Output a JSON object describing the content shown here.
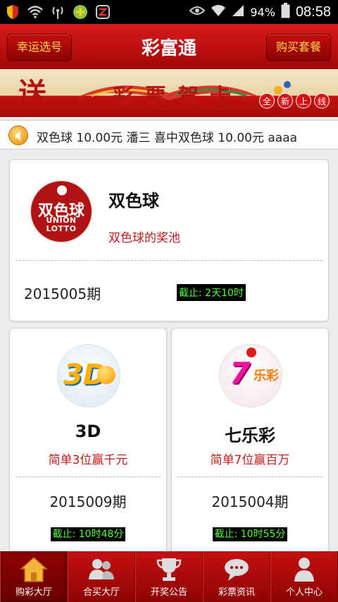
{
  "status_bar": {
    "battery_percent": "94%",
    "time": "08:58"
  },
  "header": {
    "title": "彩富通",
    "left_button": "幸运选号",
    "right_button": "购买套餐"
  },
  "banner": {
    "song": "送",
    "text": "彩票贺卡",
    "tag": [
      "全",
      "新",
      "上",
      "线"
    ]
  },
  "marquee": {
    "text": "双色球 10.00元     潘三 喜中双色球 10.00元     aaaa"
  },
  "games": {
    "ssq": {
      "logo_cn": "双色球",
      "logo_en": "UNION LOTTO",
      "name": "双色球",
      "desc": "双色球的奖池",
      "issue": "2015005期",
      "deadline": "截止: 2天10时"
    },
    "fc3d": {
      "logo_text": "3D",
      "name": "3D",
      "desc": "简单3位赢千元",
      "issue": "2015009期",
      "deadline": "截止: 10时48分"
    },
    "qlc": {
      "logo_text": "7",
      "logo_small": "乐彩",
      "name": "七乐彩",
      "desc": "简单7位赢百万",
      "issue": "2015004期",
      "deadline": "截止: 10时55分"
    }
  },
  "tabs": [
    {
      "label": "购彩大厅",
      "icon": "home-icon"
    },
    {
      "label": "合买大厅",
      "icon": "group-icon"
    },
    {
      "label": "开奖公告",
      "icon": "trophy-icon"
    },
    {
      "label": "彩票资讯",
      "icon": "chat-bubble-icon"
    },
    {
      "label": "个人中心",
      "icon": "person-icon"
    }
  ],
  "colors": {
    "brand_red": "#c41010",
    "accent_gold": "#ffd84c",
    "desc_red": "#c41b1b",
    "deadline_green": "#4eff35"
  }
}
